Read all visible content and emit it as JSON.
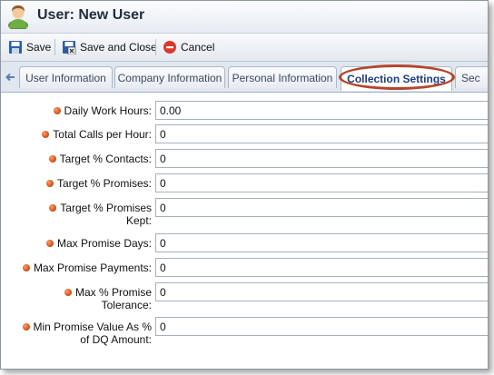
{
  "window": {
    "title": "User: New User"
  },
  "toolbar": {
    "save_label": "Save",
    "save_close_label": "Save and Close",
    "cancel_label": "Cancel"
  },
  "tabs": [
    {
      "label": "User Information"
    },
    {
      "label": "Company Information"
    },
    {
      "label": "Personal Information"
    },
    {
      "label": "Collection Settings",
      "active": true
    },
    {
      "label": "Sec"
    }
  ],
  "form": {
    "fields": [
      {
        "label": "Daily Work Hours:",
        "value": "0.00"
      },
      {
        "label": "Total Calls per Hour:",
        "value": "0"
      },
      {
        "label": "Target % Contacts:",
        "value": "0"
      },
      {
        "label": "Target % Promises:",
        "value": "0"
      },
      {
        "label_line1": "Target % Promises",
        "label_line2": "Kept:",
        "value": "0"
      },
      {
        "label": "Max Promise Days:",
        "value": "0"
      },
      {
        "label": "Max Promise Payments:",
        "value": "0"
      },
      {
        "label_line1": "Max % Promise",
        "label_line2": "Tolerance:",
        "value": "0"
      },
      {
        "label_line1": "Min Promise Value As %",
        "label_line2": "of DQ Amount:",
        "value": "0"
      }
    ]
  },
  "colors": {
    "required_dot": "#d9531a",
    "highlight_ring": "#b5462e",
    "active_tab_text": "#1b3d8c"
  },
  "icons": [
    "user-icon",
    "save-icon",
    "save-close-icon",
    "cancel-icon",
    "back-arrow-icon",
    "required-dot-icon"
  ]
}
